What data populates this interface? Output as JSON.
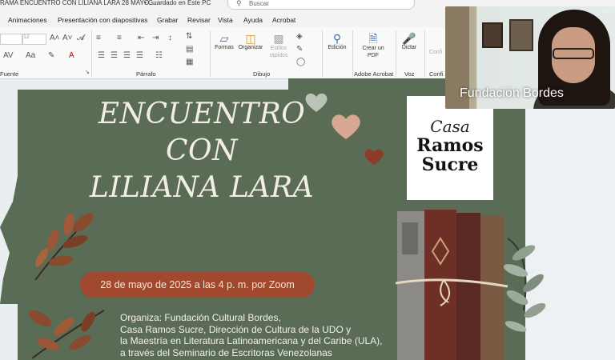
{
  "titlebar": {
    "document_title": "RAMA ENCUENTRO CON LILIANA LARA 28 MAYO...",
    "save_status": "• Guardado en Este PC",
    "search_placeholder": "Buscar"
  },
  "menu": {
    "tabs": [
      "Animaciones",
      "Presentación con diapositivas",
      "Grabar",
      "Revisar",
      "Vista",
      "Ayuda",
      "Acrobat"
    ]
  },
  "ribbon": {
    "font_size": "12",
    "groups": {
      "fuente": "Fuente",
      "parrafo": "Párrafo",
      "dibujo": "Dibujo",
      "adobe": "Adobe Acrobat",
      "voz": "Voz",
      "confi": "Confi"
    },
    "buttons": {
      "formas": "Formas",
      "organizar": "Organizar",
      "estilos": "Estilos rápidos",
      "edicion": "Edición",
      "crear_pdf": "Crear un PDF",
      "dictar": "Dictar",
      "confi": "Confi"
    }
  },
  "video": {
    "participant_name": "Fundación Bordes"
  },
  "slide": {
    "heading_lines": [
      "ENCUENTRO",
      "CON",
      "LILIANA LARA"
    ],
    "logo": {
      "line1": "Casa",
      "line2": "Ramos",
      "line3": "Sucre"
    },
    "date_line": "28 de mayo  de 2025 a las 4 p. m. por Zoom",
    "organizers": [
      "Organiza: Fundación Cultural Bordes,",
      "Casa Ramos Sucre, Dirección de Cultura de la UDO  y",
      "la Maestría en Literatura Latinoamericana y del Caribe (ULA),",
      "a través del Seminario de Escritoras Venezolanas"
    ]
  },
  "colors": {
    "slide_bg": "#5a6b56",
    "pill": "#a0492f",
    "ribbon_icon": "#3a6fb7"
  }
}
